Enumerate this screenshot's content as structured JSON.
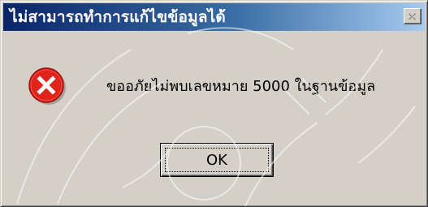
{
  "dialog": {
    "title": "ไม่สามารถทำการแก้ไขข้อมูลได้",
    "message": "ขออภัยไม่พบเลขหมาย 5000 ในฐานข้อมูล",
    "ok_label": "OK"
  },
  "icons": {
    "error": "error-icon",
    "close": "close-icon"
  },
  "colors": {
    "face": "#d4d0c8",
    "title_start": "#0a246a",
    "title_end": "#a6caf0",
    "error_red": "#e0241b"
  }
}
